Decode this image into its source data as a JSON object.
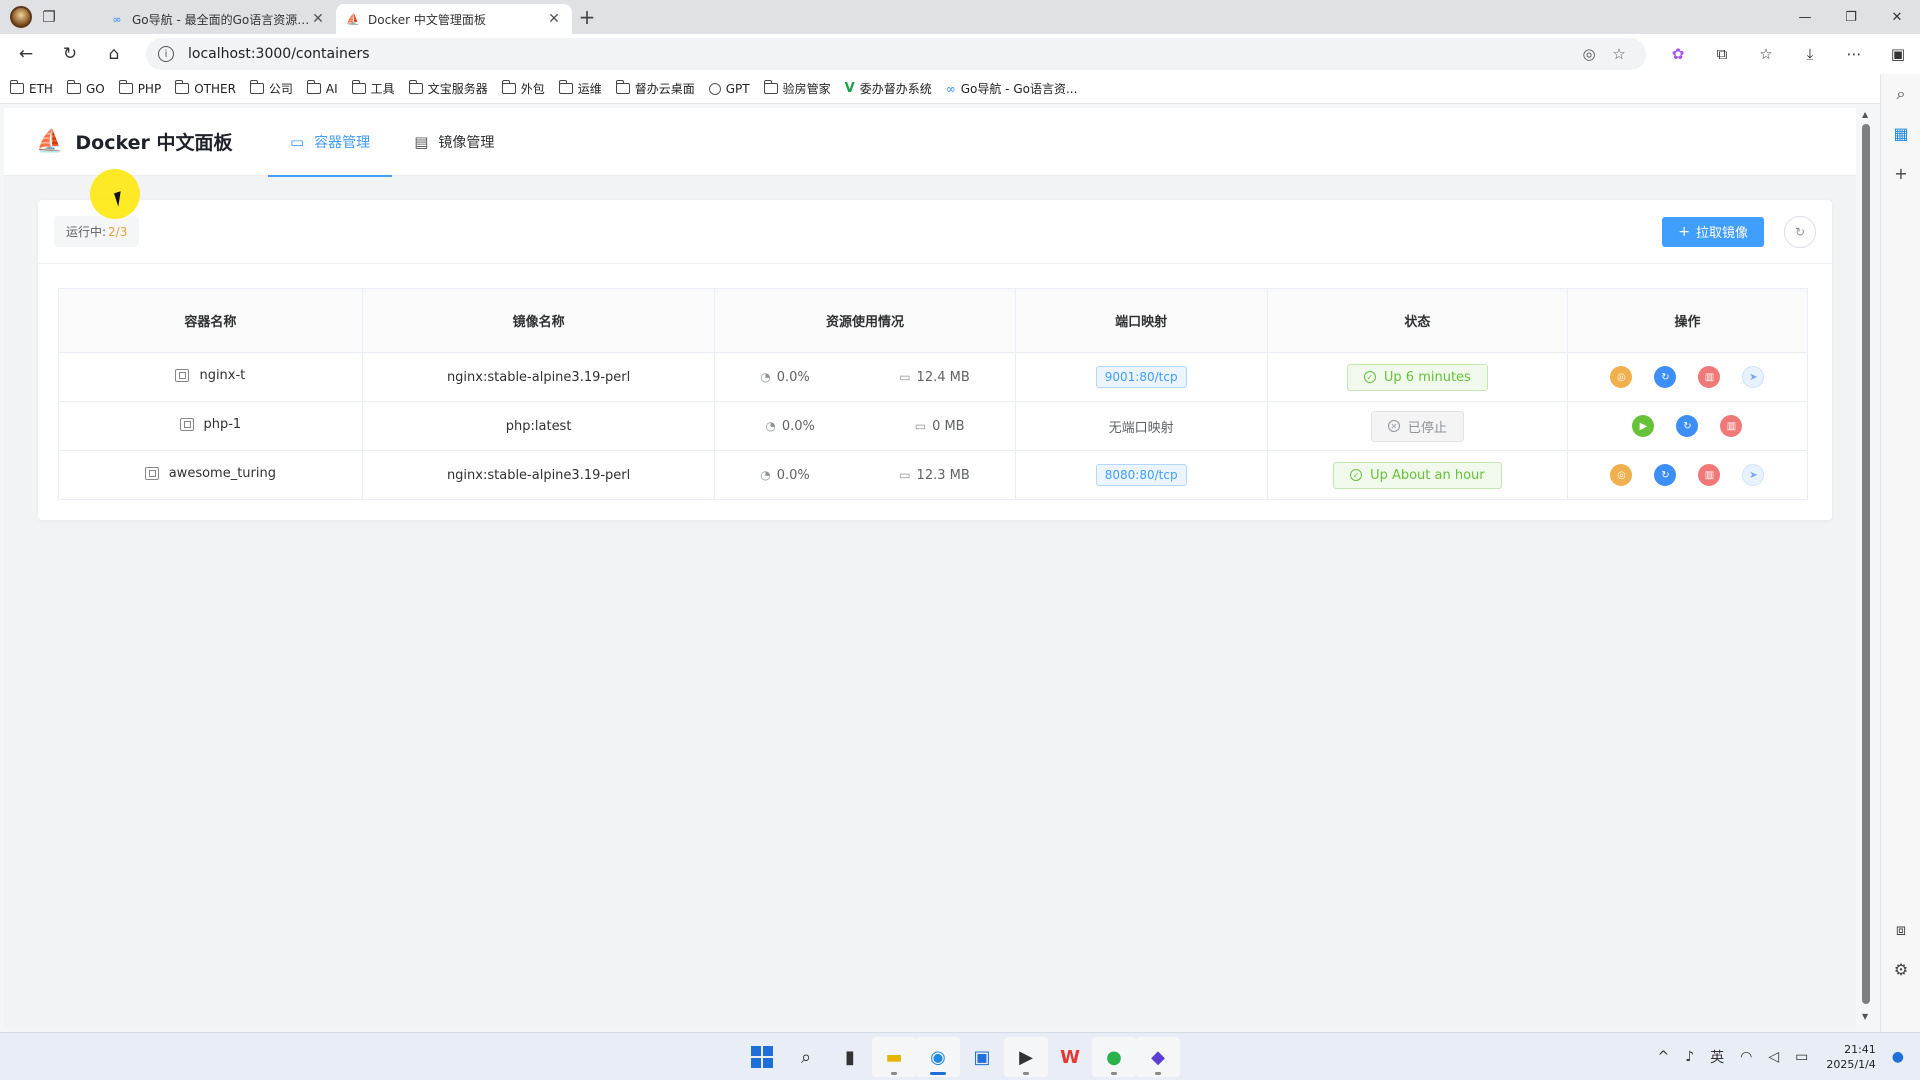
{
  "browser": {
    "tabs": [
      {
        "title": "Go导航 - 最全面的Go语言资源导航",
        "active": false
      },
      {
        "title": "Docker 中文管理面板",
        "active": true
      }
    ],
    "url": "localhost:3000/containers",
    "bookmarks": [
      {
        "label": "ETH",
        "icon": "folder"
      },
      {
        "label": "GO",
        "icon": "folder"
      },
      {
        "label": "PHP",
        "icon": "folder"
      },
      {
        "label": "OTHER",
        "icon": "folder"
      },
      {
        "label": "公司",
        "icon": "folder"
      },
      {
        "label": "AI",
        "icon": "folder"
      },
      {
        "label": "工具",
        "icon": "folder"
      },
      {
        "label": "文宝服务器",
        "icon": "folder"
      },
      {
        "label": "外包",
        "icon": "folder"
      },
      {
        "label": "运维",
        "icon": "folder"
      },
      {
        "label": "督办云桌面",
        "icon": "folder"
      },
      {
        "label": "GPT",
        "icon": "gpt"
      },
      {
        "label": "验房管家",
        "icon": "folder"
      },
      {
        "label": "委办督办系统",
        "icon": "v-logo"
      },
      {
        "label": "Go导航 - Go语言资...",
        "icon": "go-logo"
      }
    ]
  },
  "app": {
    "brand": "Docker 中文面板",
    "nav": [
      {
        "label": "容器管理",
        "icon": "monitor-icon",
        "active": true
      },
      {
        "label": "镜像管理",
        "icon": "box-icon",
        "active": false
      }
    ],
    "running_label": "运行中:",
    "running_count": "2/3",
    "pull_button": "拉取镜像",
    "table": {
      "headers": [
        "容器名称",
        "镜像名称",
        "资源使用情况",
        "端口映射",
        "状态",
        "操作"
      ],
      "rows": [
        {
          "name": "nginx-t",
          "image": "nginx:stable-alpine3.19-perl",
          "cpu": "0.0%",
          "mem": "12.4 MB",
          "port": "9001:80/tcp",
          "status": "Up 6 minutes",
          "state": "running"
        },
        {
          "name": "php-1",
          "image": "php:latest",
          "cpu": "0.0%",
          "mem": "0 MB",
          "port": "无端口映射",
          "status": "已停止",
          "state": "stopped"
        },
        {
          "name": "awesome_turing",
          "image": "nginx:stable-alpine3.19-perl",
          "cpu": "0.0%",
          "mem": "12.3 MB",
          "port": "8080:80/tcp",
          "status": "Up About an hour",
          "state": "running"
        }
      ]
    }
  },
  "taskbar": {
    "input_method": "英",
    "time": "21:41",
    "date": "2025/1/4"
  },
  "colors": {
    "primary": "#409eff",
    "success": "#67c23a",
    "warning": "#f0b04e",
    "danger": "#f07878",
    "info": "#909399"
  }
}
